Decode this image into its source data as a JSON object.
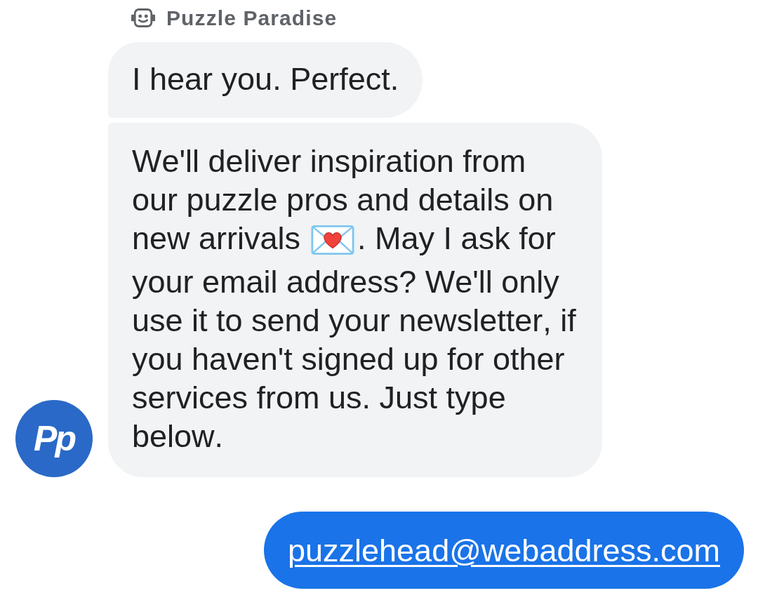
{
  "sender": {
    "name": "Puzzle Paradise",
    "logo": "Pp"
  },
  "bot_messages": [
    {
      "parts": [
        {
          "kind": "text",
          "text": "I hear you. Perfect."
        }
      ]
    },
    {
      "parts": [
        {
          "kind": "text",
          "text": "We'll deliver inspiration from our puzzle pros and details on new arrivals"
        },
        {
          "kind": "emoji"
        },
        {
          "kind": "text",
          "text": ". May I ask for your email address? We'll only use it to send your newsletter, if you haven't signed up for other services from us. Just type below."
        }
      ]
    }
  ],
  "user_messages": [
    {
      "text": "puzzlehead@webaddress.com",
      "link": true
    }
  ]
}
